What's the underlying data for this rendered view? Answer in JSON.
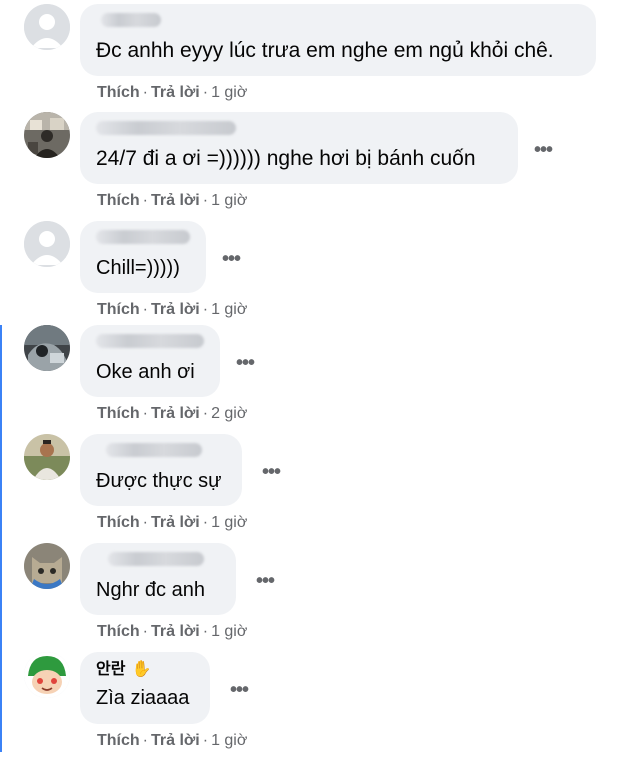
{
  "comments": [
    {
      "text": "Đc anhh eyyy lúc trưa em nghe em ngủ khỏi chê.",
      "like": "Thích",
      "reply": "Trả lời",
      "time": "1 giờ",
      "avatar": "default-avatar"
    },
    {
      "text": "24/7 đi a ơi =)))))) nghe hơi bị bánh cuốn",
      "like": "Thích",
      "reply": "Trả lời",
      "time": "1 giờ",
      "avatar": "photo-avatar"
    },
    {
      "text": "Chill=)))))",
      "like": "Thích",
      "reply": "Trả lời",
      "time": "1 giờ",
      "avatar": "default-avatar"
    },
    {
      "text": "Oke anh ơi",
      "like": "Thích",
      "reply": "Trả lời",
      "time": "2 giờ",
      "avatar": "photo-avatar"
    },
    {
      "text": "Được thực sự",
      "like": "Thích",
      "reply": "Trả lời",
      "time": "1 giờ",
      "avatar": "photo-avatar"
    },
    {
      "text": "Nghr đc anh",
      "like": "Thích",
      "reply": "Trả lời",
      "time": "1 giờ",
      "avatar": "cat-avatar"
    },
    {
      "name": "안란",
      "text": "Zìa ziaaaa",
      "like": "Thích",
      "reply": "Trả lời",
      "time": "1 giờ",
      "avatar": "cartoon-avatar"
    }
  ],
  "more_label": "•••",
  "dot_separator": "·"
}
